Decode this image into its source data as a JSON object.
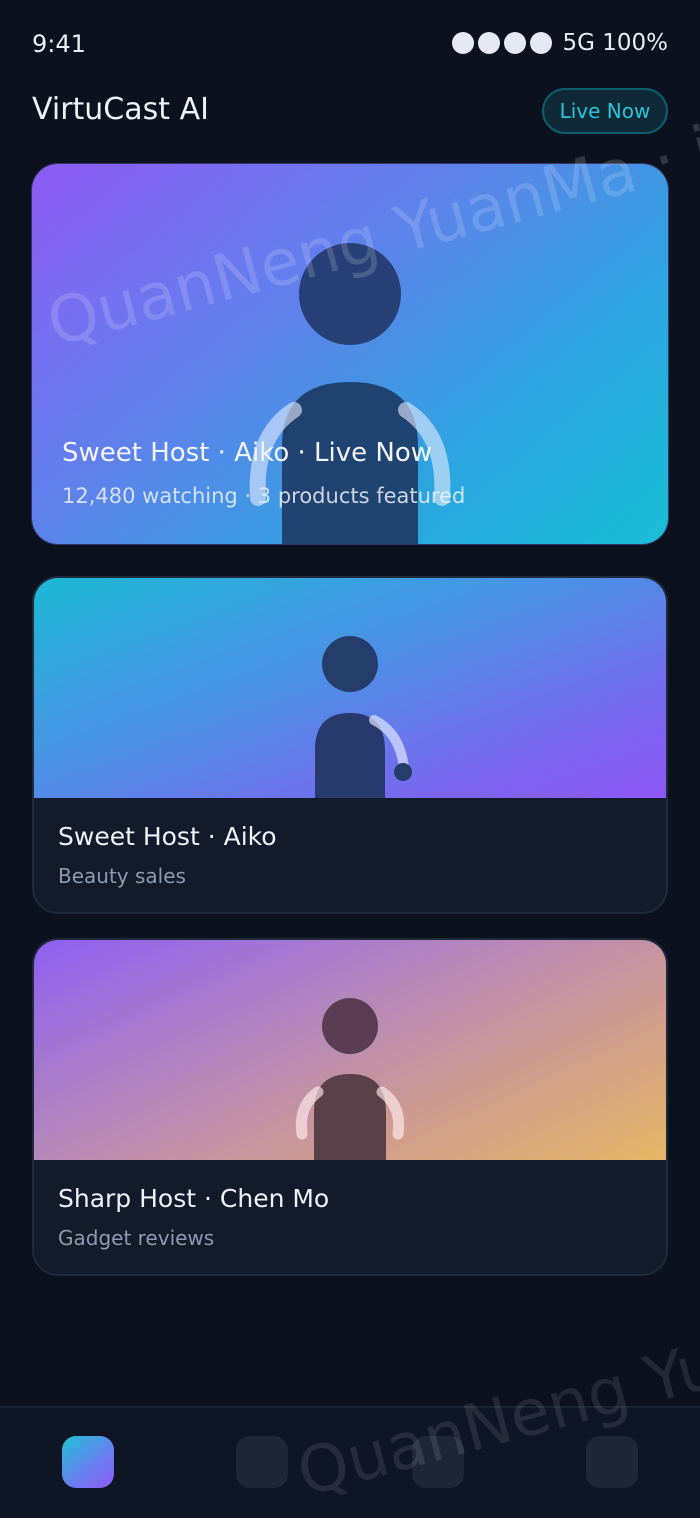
{
  "status": {
    "time": "9:41",
    "network": "5G 100%",
    "signal_icon": "signal-dots-icon"
  },
  "header": {
    "title": "VirtuCast AI",
    "live_button": "Live Now"
  },
  "featured": {
    "title": "Sweet Host · Aiko · Live Now",
    "subtitle": "12,480 watching · 3 products featured",
    "gradient": [
      "#8f5bf5",
      "#19bed6"
    ]
  },
  "hosts": [
    {
      "name": "Sweet Host · Aiko",
      "category": "Beauty sales",
      "gradient": [
        "#1cb9d4",
        "#8d58f6"
      ]
    },
    {
      "name": "Sharp Host · Chen Mo",
      "category": "Gadget reviews",
      "gradient": [
        "#8e5ff2",
        "#e6b665"
      ]
    }
  ],
  "watermark": "QuanNeng YuanMa · in",
  "nav": {
    "items": [
      "home-icon",
      "explore-icon",
      "studio-icon",
      "profile-icon"
    ],
    "active_index": 0
  },
  "colors": {
    "background": "#0b111d",
    "card": "#131b2b",
    "accent": "#2bc4d8"
  }
}
